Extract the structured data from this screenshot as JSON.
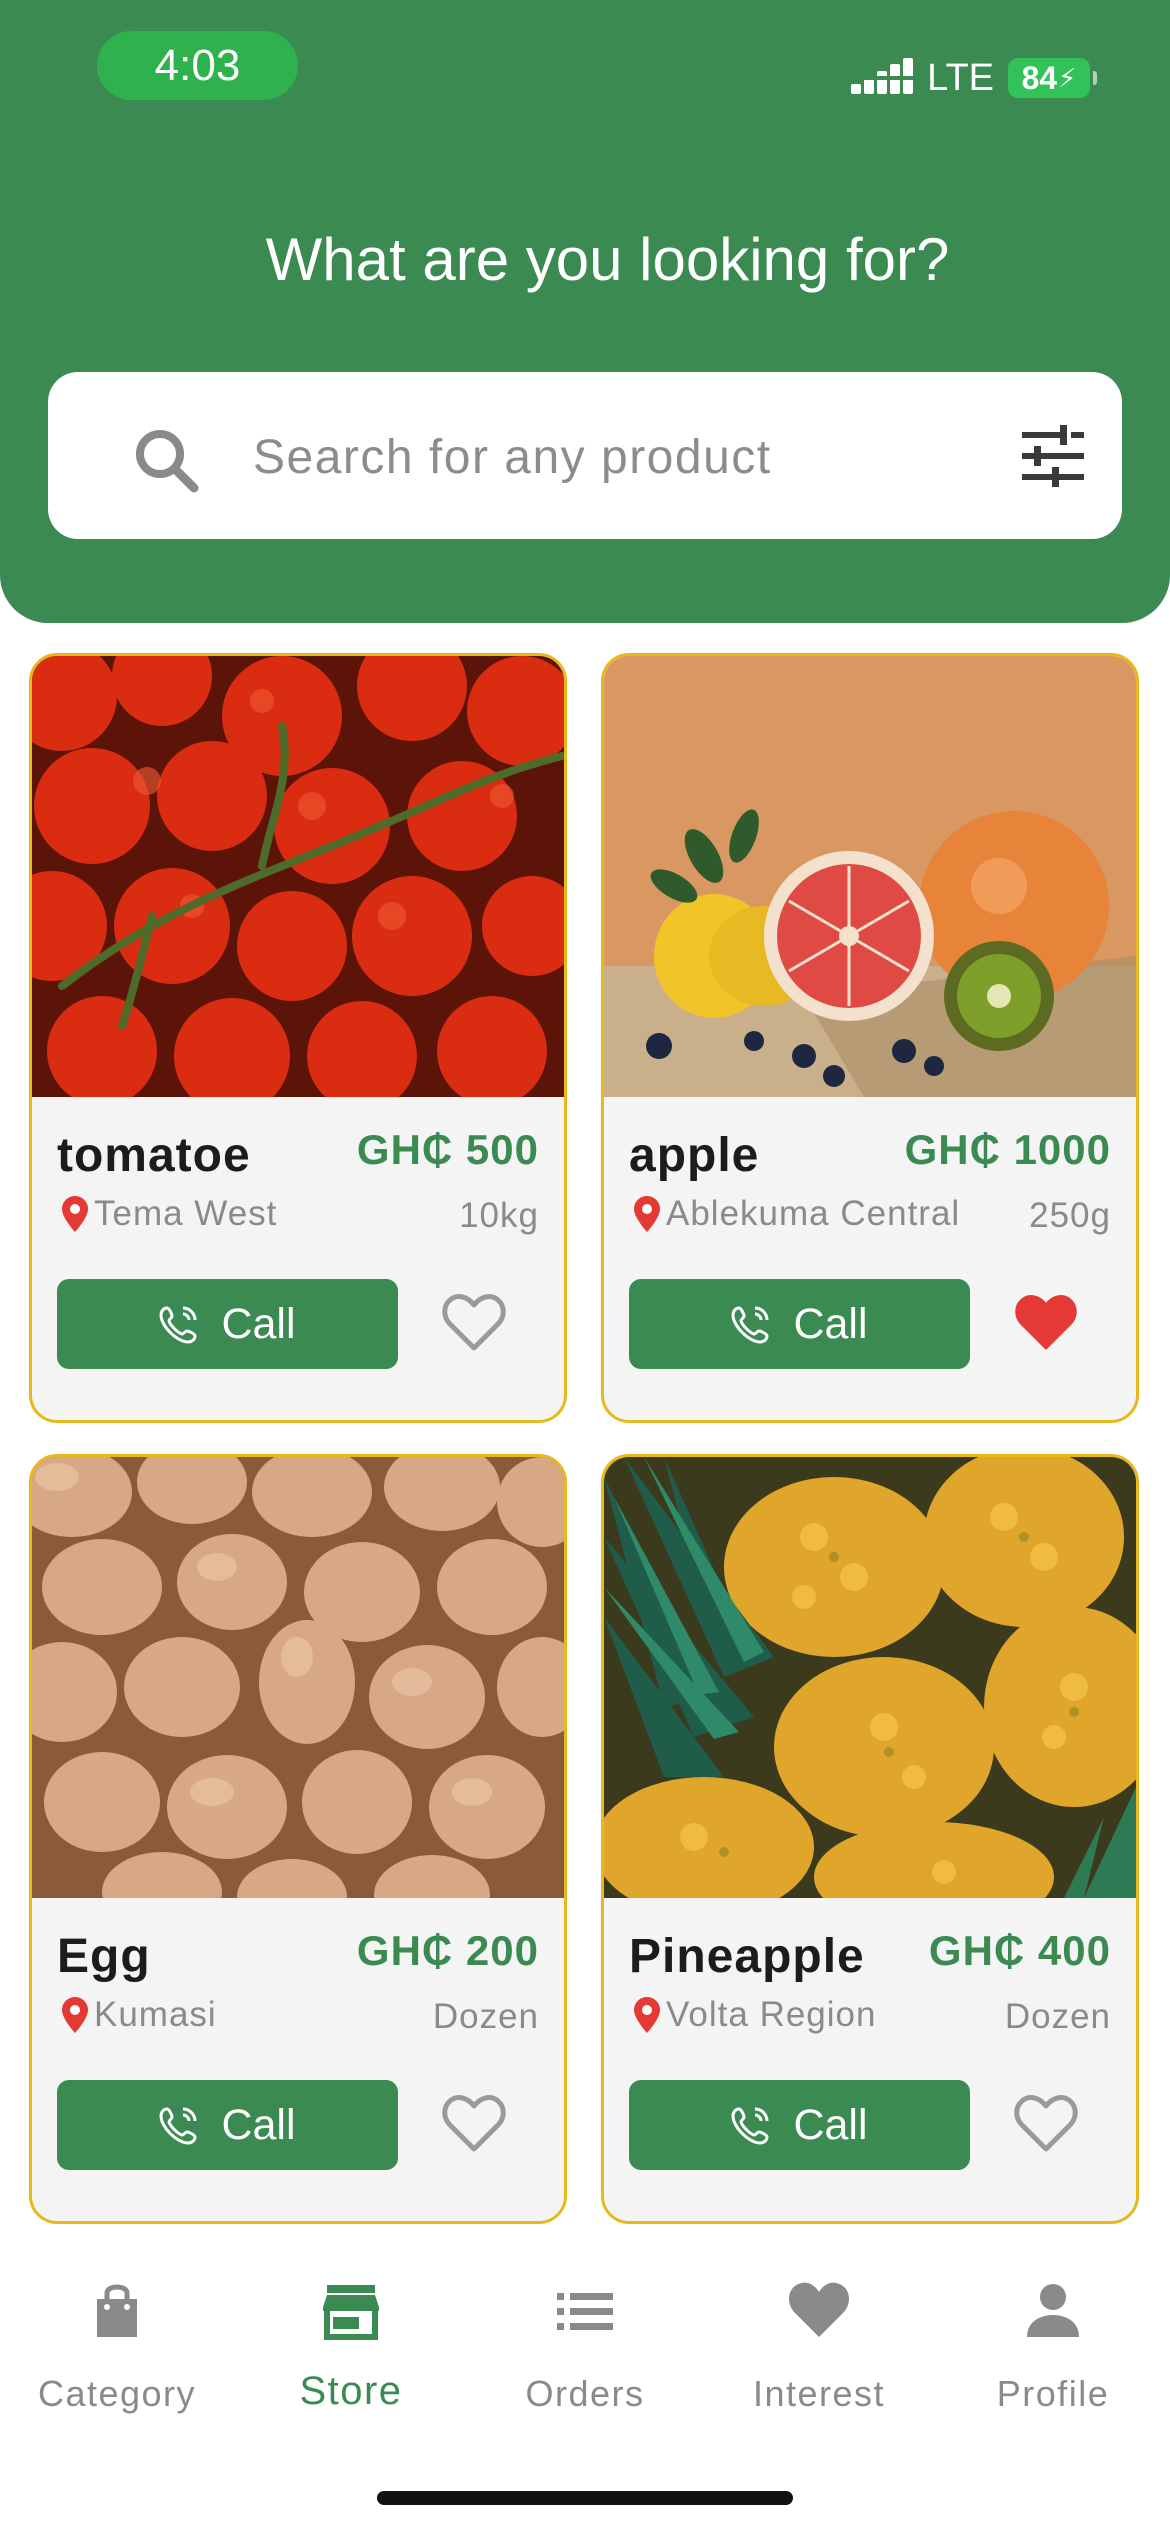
{
  "status_bar": {
    "time": "4:03",
    "network": "LTE",
    "battery": "84"
  },
  "header": {
    "title": "What are you looking for?"
  },
  "search": {
    "placeholder": "Search for any product"
  },
  "products": [
    {
      "name": "tomatoe",
      "price": "GH₵ 500",
      "location": "Tema West",
      "unit": "10kg",
      "call_label": "Call",
      "favorited": false
    },
    {
      "name": "apple",
      "price": "GH₵ 1000",
      "location": "Ablekuma Central",
      "unit": "250g",
      "call_label": "Call",
      "favorited": true
    },
    {
      "name": "Egg",
      "price": "GH₵ 200",
      "location": "Kumasi",
      "unit": "Dozen",
      "call_label": "Call",
      "favorited": false
    },
    {
      "name": "Pineapple",
      "price": "GH₵ 400",
      "location": "Volta Region",
      "unit": "Dozen",
      "call_label": "Call",
      "favorited": false
    }
  ],
  "nav": {
    "items": [
      {
        "label": "Category",
        "icon": "shopping-bag-icon"
      },
      {
        "label": "Store",
        "icon": "store-icon",
        "active": true
      },
      {
        "label": "Orders",
        "icon": "list-icon"
      },
      {
        "label": "Interest",
        "icon": "heart-icon"
      },
      {
        "label": "Profile",
        "icon": "person-icon"
      }
    ]
  },
  "colors": {
    "primary": "#3b8a52",
    "card_border": "#e6b91f",
    "favorite": "#e53935",
    "status_time_pill": "#2fb24e"
  }
}
